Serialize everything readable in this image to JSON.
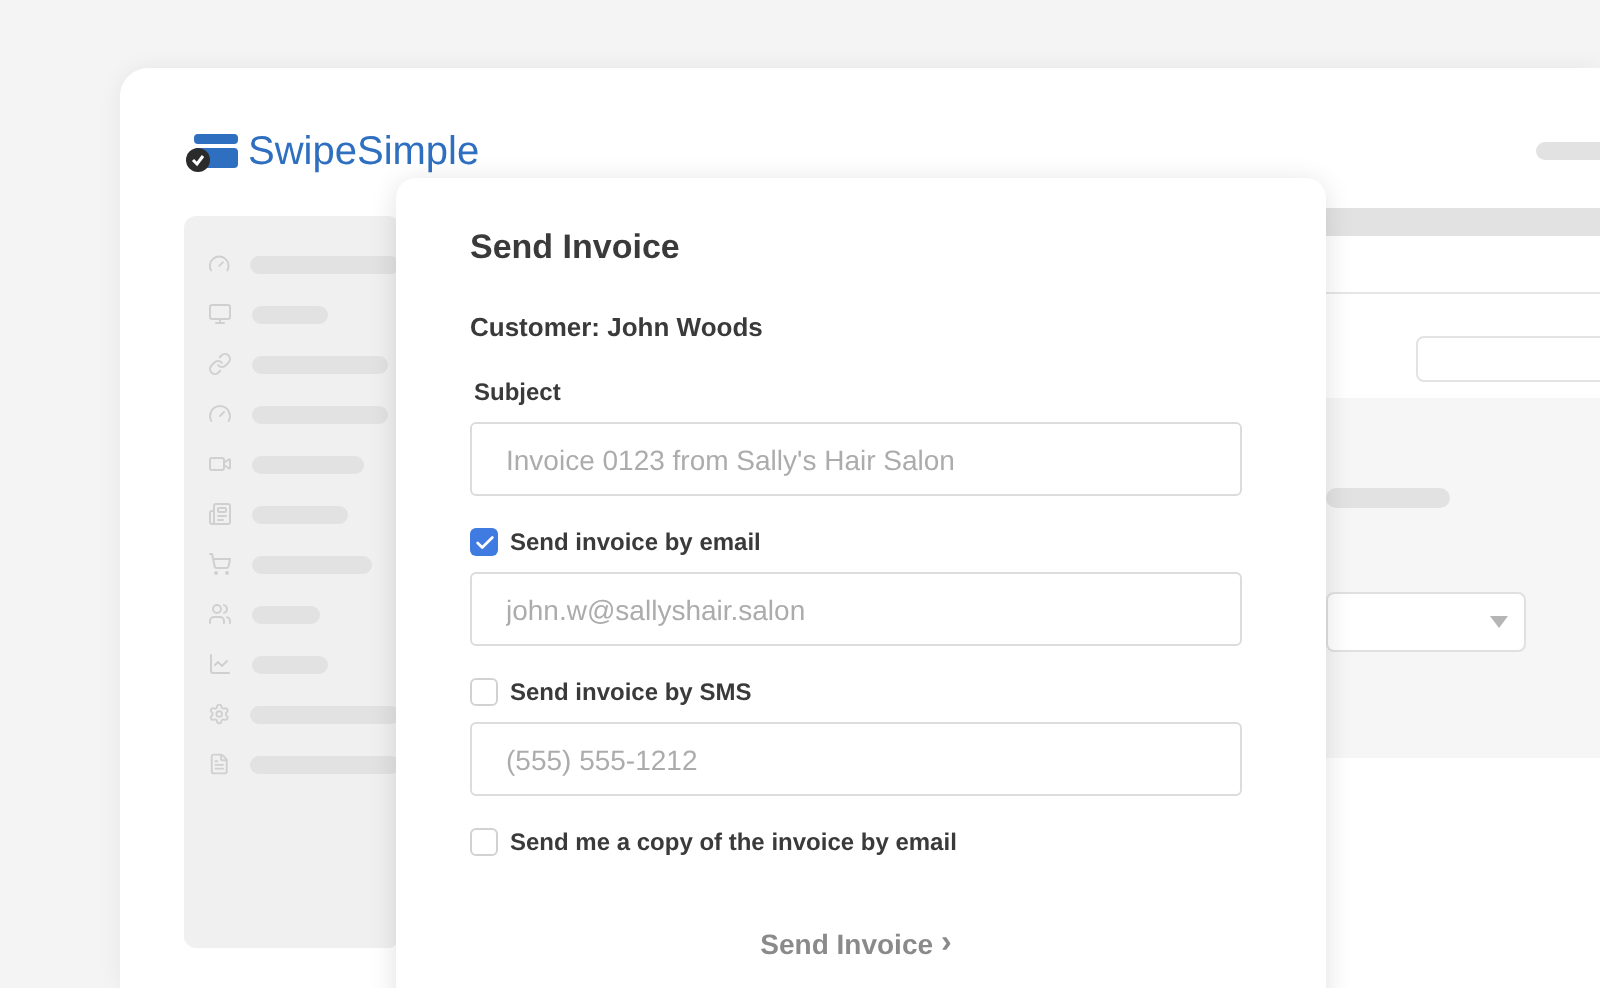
{
  "logo": {
    "text": "SwipeSimple"
  },
  "dialog": {
    "title": "Send Invoice",
    "customer": "Customer: John Woods",
    "fields": [
      {
        "kind": "label",
        "text": "Subject"
      },
      {
        "kind": "input",
        "placeholder": "Invoice 0123 from Sally's Hair Salon"
      },
      {
        "kind": "checkbox",
        "label": "Send invoice by email",
        "checked": true
      },
      {
        "kind": "input",
        "placeholder": "john.w@sallyshair.salon"
      },
      {
        "kind": "checkbox",
        "label": "Send invoice by SMS",
        "checked": false
      },
      {
        "kind": "input",
        "placeholder": "(555) 555-1212"
      },
      {
        "kind": "checkbox",
        "label": "Send me a copy of the invoice by email",
        "checked": false
      }
    ],
    "submit": {
      "label": "Send Invoice",
      "chevron": "›"
    }
  }
}
